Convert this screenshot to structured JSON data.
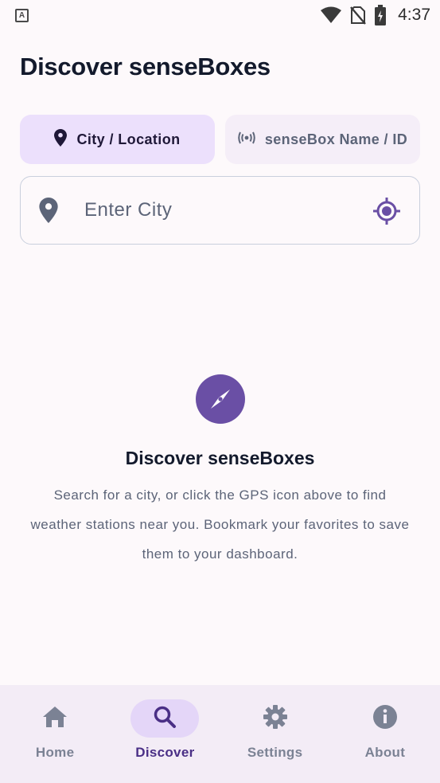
{
  "status_bar": {
    "app_badge": "A",
    "time": "4:37",
    "icons": [
      "wifi-icon",
      "no-sim-icon",
      "battery-charging-icon"
    ]
  },
  "page": {
    "title": "Discover senseBoxes"
  },
  "search_modes": [
    {
      "label": "City / Location",
      "icon": "location-pin-icon",
      "selected": true
    },
    {
      "label": "senseBox Name / ID",
      "icon": "broadcast-icon",
      "selected": false
    }
  ],
  "city_search": {
    "placeholder": "Enter City",
    "value": "",
    "leading_icon": "location-pin-icon",
    "trailing_icon": "gps-target-icon"
  },
  "empty_state": {
    "icon": "compass-icon",
    "title": "Discover senseBoxes",
    "body": "Search for a city, or click the GPS icon above to find weather stations near you. Bookmark your favorites to save them to your dashboard."
  },
  "bottom_nav": {
    "items": [
      {
        "label": "Home",
        "icon": "home-icon",
        "active": false
      },
      {
        "label": "Discover",
        "icon": "search-icon",
        "active": true
      },
      {
        "label": "Settings",
        "icon": "gear-icon",
        "active": false
      },
      {
        "label": "About",
        "icon": "info-icon",
        "active": false
      }
    ]
  },
  "colors": {
    "background": "#fdf9fb",
    "accent": "#6a4fa5",
    "selected_tab_bg": "#ece0fc",
    "nav_bg": "#f3ecf6",
    "muted_text": "#5c6478"
  }
}
